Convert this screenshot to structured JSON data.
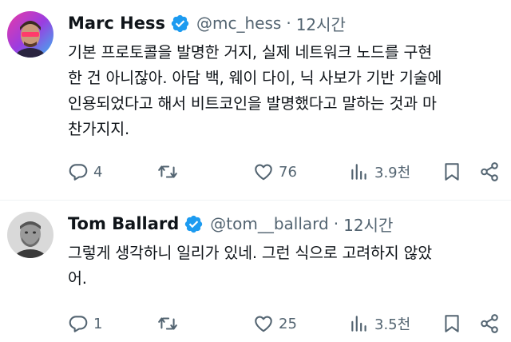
{
  "tweets": [
    {
      "name": "Marc Hess",
      "handle": "@mc_hess",
      "separator": "·",
      "time": "12시간",
      "lines": [
        "기본 프로토콜을 발명한 거지, 실제 네트워크 노드를 구현",
        "한 건 아니잖아. 아담 백, 웨이 다이, 닉 사보가 기반 기술에",
        "인용되었다고 해서 비트코인을 발명했다고 말하는 것과 마",
        "찬가지지."
      ],
      "replies": "4",
      "retweets": "",
      "likes": "76",
      "views": "3.9천"
    },
    {
      "name": "Tom Ballard",
      "handle": "@tom__ballard",
      "separator": "·",
      "time": "12시간",
      "lines": [
        "그렇게 생각하니 일리가 있네. 그런 식으로 고려하지 않았",
        "어."
      ],
      "replies": "1",
      "retweets": "",
      "likes": "25",
      "views": "3.5천"
    }
  ],
  "icons": {
    "verified": "verified-badge-icon",
    "reply": "reply-icon",
    "retweet": "retweet-icon",
    "like": "like-icon",
    "views": "views-icon",
    "bookmark": "bookmark-icon",
    "share": "share-icon"
  },
  "colors": {
    "verified": "#1d9bf0",
    "secondary_text": "#536471",
    "primary_text": "#0f1419"
  }
}
